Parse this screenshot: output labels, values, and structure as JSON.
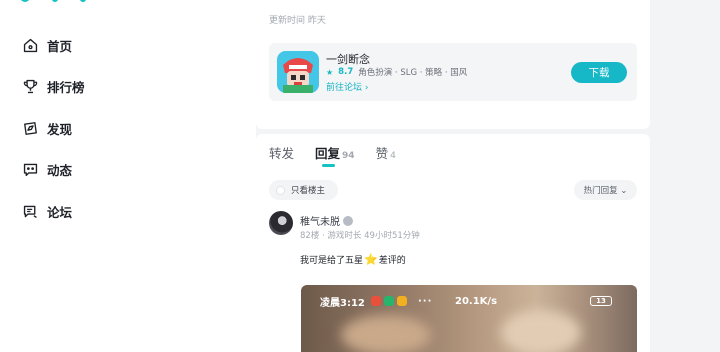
{
  "sidebar": {
    "items": [
      {
        "label": "首页",
        "icon": "home-icon"
      },
      {
        "label": "排行榜",
        "icon": "trophy-icon"
      },
      {
        "label": "发现",
        "icon": "discover-icon"
      },
      {
        "label": "动态",
        "icon": "feed-icon"
      },
      {
        "label": "论坛",
        "icon": "forum-icon"
      }
    ]
  },
  "post": {
    "update_time": "更新时间 昨天"
  },
  "game": {
    "name": "一剑断念",
    "score": "8.7",
    "tags": "角色扮演 · SLG · 策略 · 国风",
    "forum_link": "前往论坛 ›",
    "download_label": "下载",
    "accent_color": "#16b8c8"
  },
  "tabs": [
    {
      "label": "转发",
      "count": ""
    },
    {
      "label": "回复",
      "count": "94"
    },
    {
      "label": "赞",
      "count": "4"
    }
  ],
  "filters": {
    "only_author": "只看楼主",
    "sort": "热门回复 ⌄"
  },
  "comment": {
    "user": "稚气未脱",
    "meta": "82楼 · 游戏时长 49小时51分钟",
    "text_before": "我可是给了五星",
    "text_after": "差评的"
  },
  "embedded_screenshot": {
    "time": "凌晨3:12",
    "more": "···",
    "speed": "20.1K/s",
    "battery": "13"
  }
}
